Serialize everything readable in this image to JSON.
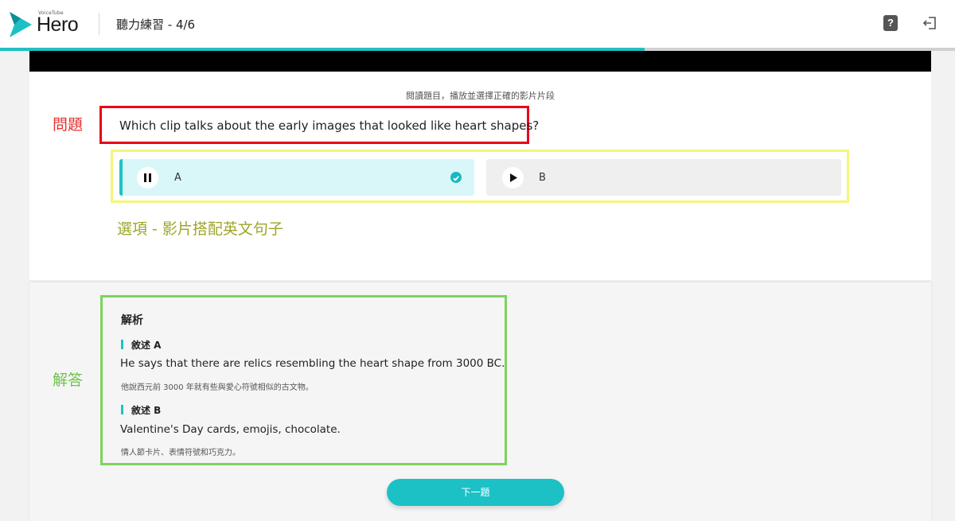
{
  "header": {
    "brand_small": "VoiceTube",
    "brand": "Hero",
    "page_title": "聽力練習 - 4/6",
    "help_icon": "question-mark-icon",
    "exit_icon": "logout-icon"
  },
  "progress": {
    "value": 0.675
  },
  "question": {
    "instruction": "閱讀題目，播放並選擇正確的影片片段",
    "text": "Which clip talks about the early images that looked like heart shapes?"
  },
  "options": [
    {
      "letter": "A",
      "state": "playing",
      "selected": true,
      "icon": "pause-icon"
    },
    {
      "letter": "B",
      "state": "paused",
      "selected": false,
      "icon": "play-icon"
    }
  ],
  "annotations": {
    "question_label": "問題",
    "options_label": "選項 - 影片搭配英文句子",
    "answer_label": "解答"
  },
  "answer": {
    "title": "解析",
    "statements": [
      {
        "head": "敘述 A",
        "en": "He says that there are relics resembling the heart shape from 3000 BC.",
        "zh": "他說西元前 3000 年就有些與愛心符號相似的古文物。"
      },
      {
        "head": "敘述 B",
        "en": "Valentine's Day cards, emojis, chocolate.",
        "zh": "情人節卡片、表情符號和巧克力。"
      }
    ]
  },
  "next_button": {
    "label": "下一題"
  },
  "colors": {
    "accent": "#1cc1c6",
    "question_outline": "#e8001c",
    "options_outline": "#f5f57a",
    "answer_outline": "#7dd35a"
  }
}
